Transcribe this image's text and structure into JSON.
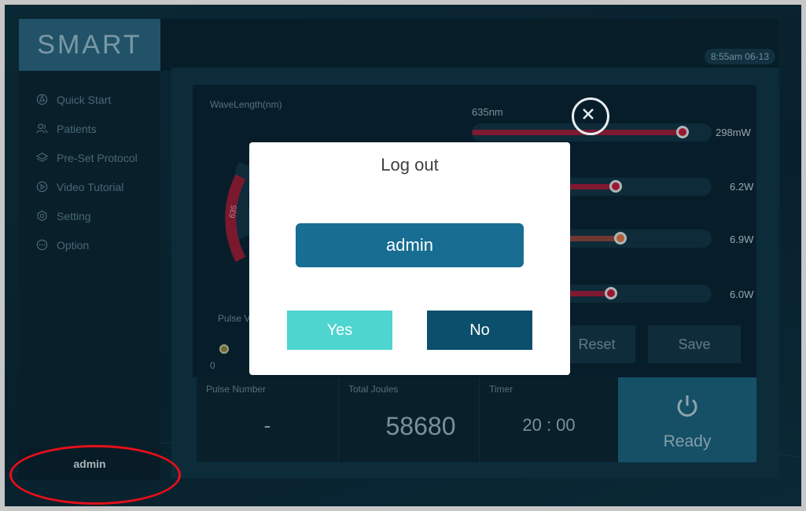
{
  "app": {
    "logo": "SMART",
    "clock": "8:55am  06-13"
  },
  "sidebar": {
    "items": [
      {
        "label": "Quick Start",
        "icon": "quick-start-icon"
      },
      {
        "label": "Patients",
        "icon": "patients-icon"
      },
      {
        "label": "Pre-Set Protocol",
        "icon": "layers-icon"
      },
      {
        "label": "Video Tutorial",
        "icon": "play-icon"
      },
      {
        "label": "Setting",
        "icon": "gear-icon"
      },
      {
        "label": "Option",
        "icon": "more-icon"
      }
    ],
    "user": "admin"
  },
  "panel": {
    "wavelength_label": "WaveLength(nm)",
    "gauge_tick": "635",
    "pulse_label": "Pulse V",
    "pulse_value": "0",
    "sliders": [
      {
        "label": "635nm",
        "value": "298mW",
        "level": 0.88,
        "color": "#c51f3f"
      },
      {
        "label": "",
        "value": "6.2W",
        "level": 0.6,
        "color": "#c51f3f"
      },
      {
        "label": "",
        "value": "6.9W",
        "level": 0.62,
        "color": "#e07a4a"
      },
      {
        "label": "",
        "value": "6.0W",
        "level": 0.58,
        "color": "#c51f3f"
      }
    ],
    "reset_label": "Reset",
    "save_label": "Save"
  },
  "stats": {
    "pulse_number_label": "Pulse Number",
    "pulse_number_value": "-",
    "total_joules_label": "Total Joules",
    "total_joules_value": "58680",
    "timer_label": "Timer",
    "timer_value": "20 : 00",
    "ready_label": "Ready"
  },
  "dialog": {
    "title": "Log out",
    "user": "admin",
    "yes": "Yes",
    "no": "No"
  },
  "colors": {
    "accent": "#176d92",
    "yes": "#4ed5cf",
    "no": "#0c4f6d",
    "highlight": "#e60f19"
  }
}
